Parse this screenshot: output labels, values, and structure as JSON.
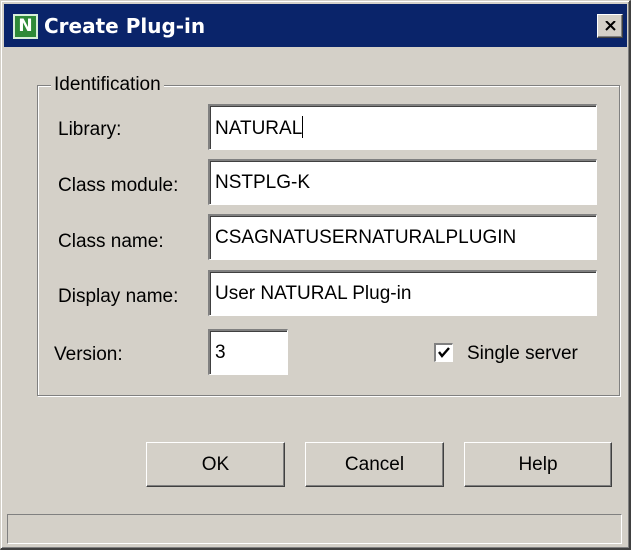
{
  "window": {
    "title": "Create Plug-in",
    "icon_letter": "N",
    "icon_name": "natural-app-icon",
    "close_icon": "close-x-icon"
  },
  "group": {
    "label": "Identification"
  },
  "fields": {
    "library": {
      "label": "Library:",
      "value": "NATURAL"
    },
    "class_module": {
      "label": "Class module:",
      "value": "NSTPLG-K"
    },
    "class_name": {
      "label": "Class name:",
      "value": "CSAGNATUSERNATURALPLUGIN"
    },
    "display_name": {
      "label": "Display name:",
      "value": "User NATURAL Plug-in"
    },
    "version": {
      "label": "Version:",
      "value": "3"
    }
  },
  "single_server": {
    "label": "Single server",
    "checked": true
  },
  "buttons": {
    "ok": "OK",
    "cancel": "Cancel",
    "help": "Help"
  },
  "statusbar": {
    "text": ""
  },
  "colors": {
    "titlebar": "#0a246a",
    "dialog_face": "#d4d0c8",
    "icon_green": "#2f8a38"
  }
}
